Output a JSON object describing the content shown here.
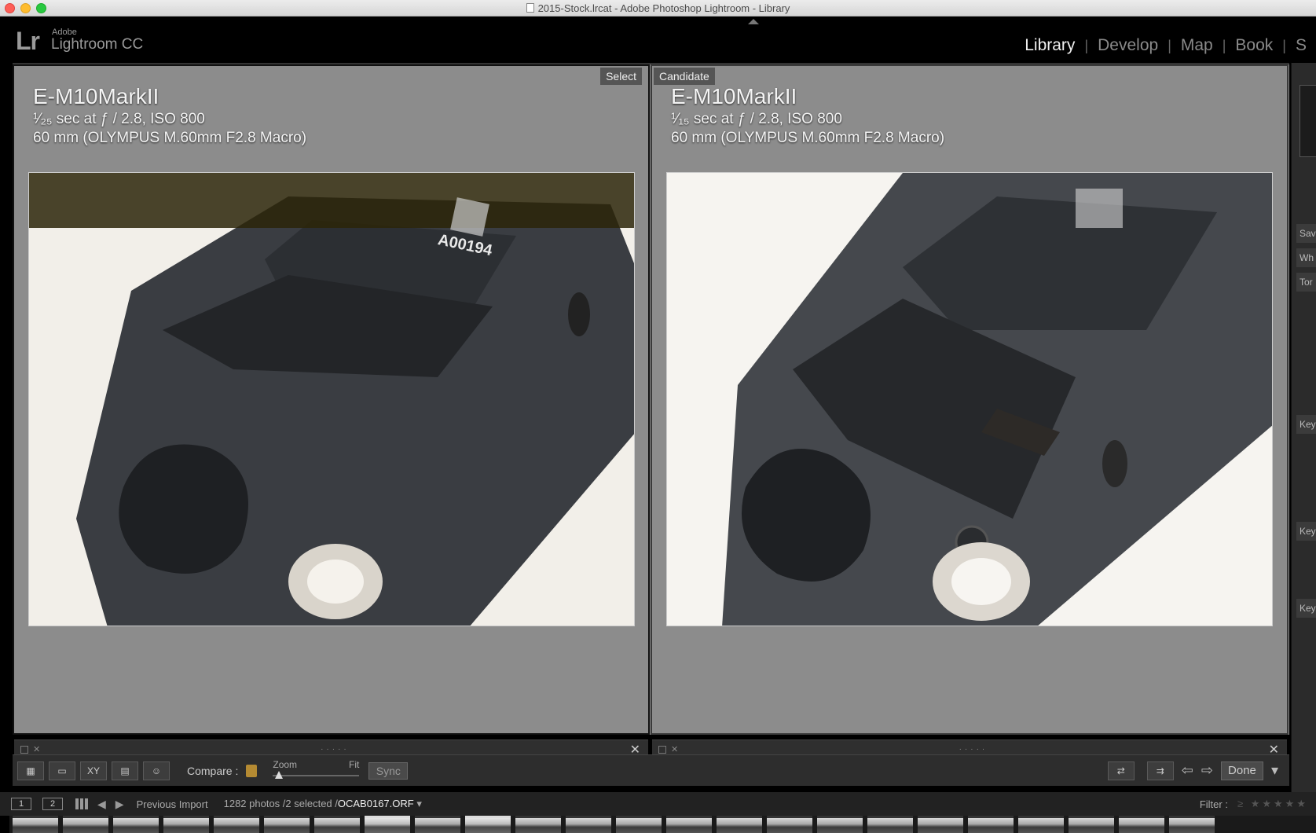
{
  "window": {
    "title": "2015-Stock.lrcat - Adobe Photoshop Lightroom - Library"
  },
  "identity": {
    "logo": "Lr",
    "adobe": "Adobe",
    "product": "Lightroom CC"
  },
  "modules": [
    {
      "label": "Library",
      "active": true
    },
    {
      "label": "Develop",
      "active": false
    },
    {
      "label": "Map",
      "active": false
    },
    {
      "label": "Book",
      "active": false
    },
    {
      "label": "S",
      "active": false
    }
  ],
  "compare": {
    "select": {
      "tag": "Select",
      "camera": "E-M10MarkII",
      "exposure": "¹⁄₂₅ sec at ƒ / 2.8, ISO 800",
      "lens": "60 mm (OLYMPUS M.60mm F2.8 Macro)",
      "label_text": "A00194"
    },
    "candidate": {
      "tag": "Candidate",
      "camera": "E-M10MarkII",
      "exposure": "¹⁄₁₅ sec at ƒ / 2.8, ISO 800",
      "lens": "60 mm (OLYMPUS M.60mm F2.8 Macro)"
    }
  },
  "right_panel": {
    "items": [
      "Sav",
      "Wh",
      "Tor",
      "Key",
      "Key",
      "Key"
    ],
    "iso_label": "ISO"
  },
  "toolbar": {
    "compare_label": "Compare :",
    "zoom_label": "Zoom",
    "fit_label": "Fit",
    "sync_label": "Sync",
    "done_label": "Done",
    "xy_label": "XY"
  },
  "filmstrip": {
    "page1": "1",
    "page2": "2",
    "source": "Previous Import",
    "count": "1282 photos /2 selected /",
    "filename": "OCAB0167.ORF",
    "filter_label": "Filter :",
    "filter_stars": "≥ ★★★★★"
  },
  "colors": {
    "accent_lock": "#b48a32",
    "compare_bg": "#8c8c8c",
    "panel_bg": "#2b2b2b"
  }
}
